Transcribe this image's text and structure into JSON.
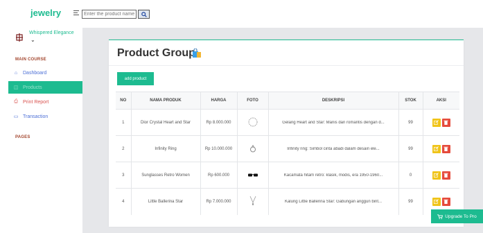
{
  "app": {
    "brand": "jewelry"
  },
  "search": {
    "placeholder": "Enter the product name"
  },
  "user": {
    "name": "Whispered Elegance",
    "caret": "⌄"
  },
  "sidebar": {
    "section_main": "MAIN COURSE",
    "section_pages": "PAGES",
    "items": [
      {
        "label": "Dashboard",
        "icon": "home-icon",
        "active": false
      },
      {
        "label": "Products",
        "icon": "box-icon",
        "active": true
      },
      {
        "label": "Print Report",
        "icon": "printer-icon",
        "active": false
      },
      {
        "label": "Transaction",
        "icon": "card-icon",
        "active": false
      }
    ]
  },
  "page": {
    "title": "Product Group",
    "add_label": "add product"
  },
  "table": {
    "headers": [
      "NO",
      "NAMA PRODUK",
      "HARGA",
      "FOTO",
      "DESKRIPSI",
      "STOK",
      "AKSI"
    ],
    "rows": [
      {
        "no": "1",
        "name": "Dior Crystal Heart and Star",
        "price": "Rp 8.000.000",
        "photo": "bracelet-photo",
        "desc": "Gelang Heart and Star: Manis dan romantis dengan d...",
        "stock": "99"
      },
      {
        "no": "2",
        "name": "Infinity Ring",
        "price": "Rp 10.000.000",
        "photo": "ring-photo",
        "desc": "Infinity ring: Simbol cinta abadi dalam desain ele...",
        "stock": "99"
      },
      {
        "no": "3",
        "name": "Sunglasses Retro Women",
        "price": "Rp 600.000",
        "photo": "sunglasses-photo",
        "desc": "Kacamata hitam retro: klasik, modis, era 1950-1960...",
        "stock": "0"
      },
      {
        "no": "4",
        "name": "Little Ballerina Star",
        "price": "Rp 7.000.000",
        "photo": "necklace-photo",
        "desc": "Kalung Little Ballerina Star: Gabungan anggun bint...",
        "stock": "99"
      }
    ]
  },
  "upgrade": {
    "label": "Upgrade To Pro"
  },
  "colors": {
    "accent": "#1dbb90",
    "edit": "#f0c419",
    "delete": "#e54b3c",
    "section": "#a2442c",
    "link": "#4c6fd6"
  }
}
